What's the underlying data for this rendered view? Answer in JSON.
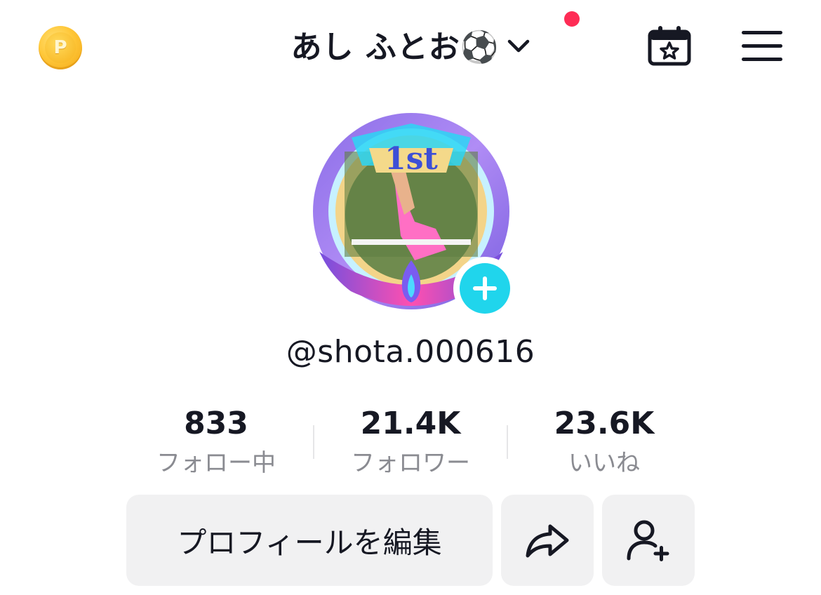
{
  "header": {
    "title": "あし ふとお⚽",
    "coin_icon": "p-coin-icon",
    "coin_letter": "P",
    "notification_dot_color": "#fe2c55",
    "calendar_icon": "calendar-star-icon",
    "menu_icon": "hamburger-menu-icon"
  },
  "profile": {
    "avatar_badge_text": "1st",
    "handle": "@shota.000616",
    "add_icon": "plus-icon",
    "add_color": "#20d5ec"
  },
  "stats": [
    {
      "value": "833",
      "label": "フォロー中"
    },
    {
      "value": "21.4K",
      "label": "フォロワー"
    },
    {
      "value": "23.6K",
      "label": "いいね"
    }
  ],
  "actions": {
    "edit_profile_label": "プロフィールを編集",
    "share_icon": "share-arrow-icon",
    "add_friend_icon": "add-friend-icon"
  }
}
